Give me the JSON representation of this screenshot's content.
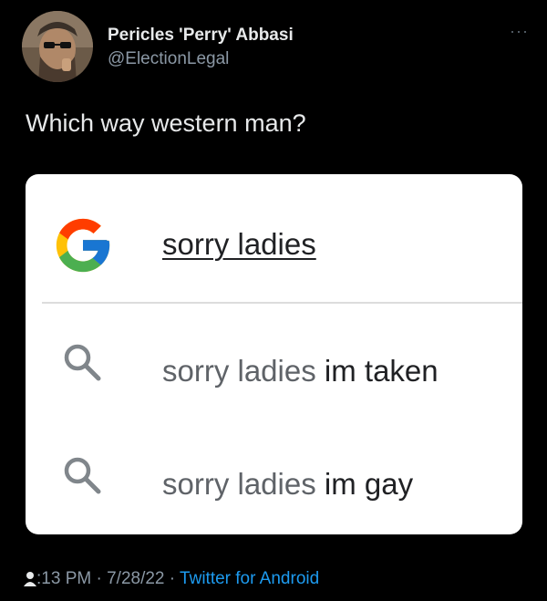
{
  "author": {
    "name": "Pericles 'Perry' Abbasi",
    "handle": "@ElectionLegal"
  },
  "menu": {
    "more_label": "···"
  },
  "tweet": {
    "text": "Which way western man?"
  },
  "search_card": {
    "query": "sorry ladies",
    "suggestions": [
      {
        "prefix": "sorry ladies",
        "completion": "im taken"
      },
      {
        "prefix": "sorry ladies",
        "completion": "im gay"
      }
    ]
  },
  "meta": {
    "time": ":13 PM",
    "sep1": " · ",
    "date": "7/28/22",
    "sep2": " · ",
    "source": "Twitter for Android"
  },
  "colors": {
    "background": "#000000",
    "link": "#1d9bf0",
    "secondary_text": "#8b98a5"
  }
}
